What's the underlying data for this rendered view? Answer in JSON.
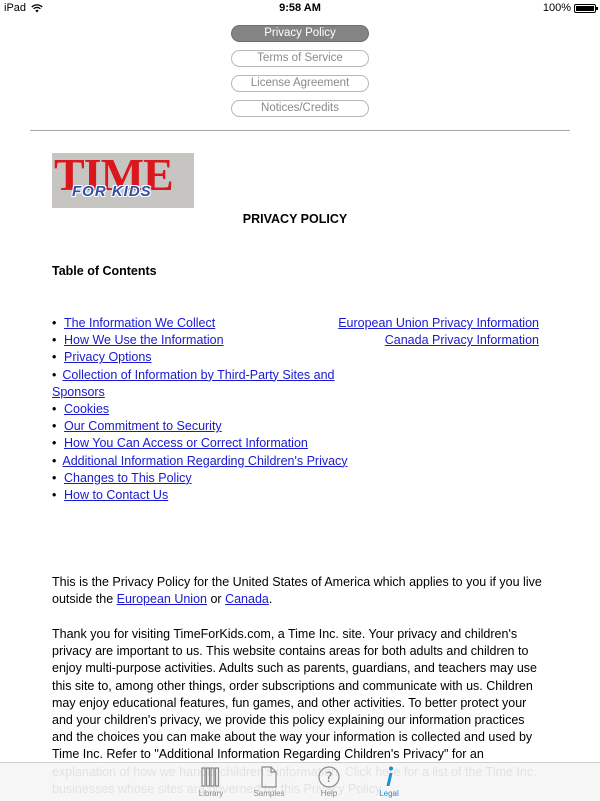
{
  "status_bar": {
    "device": "iPad",
    "time": "9:58 AM",
    "battery": "100%"
  },
  "legal_nav": {
    "buttons": [
      {
        "label": "Privacy Policy",
        "active": true
      },
      {
        "label": "Terms of Service",
        "active": false
      },
      {
        "label": "License Agreement",
        "active": false
      },
      {
        "label": "Notices/Credits",
        "active": false
      }
    ]
  },
  "logo": {
    "line1": "TIME",
    "line2": "FOR KIDS",
    "brand_red": "#d9171c",
    "brand_blue": "#2f4fa8"
  },
  "document": {
    "title": "PRIVACY POLICY",
    "toc_heading": "Table of Contents",
    "toc_left": [
      "The Information We Collect",
      "How We Use the Information",
      "Privacy Options",
      "Collection of Information by Third-Party Sites and Sponsors",
      "Cookies",
      "Our Commitment to Security",
      "How You Can Access or Correct Information",
      "Additional Information Regarding Children's Privacy",
      "Changes to This Policy",
      "How to Contact Us"
    ],
    "toc_right": [
      "European Union Privacy Information",
      "Canada Privacy Information"
    ],
    "para1": {
      "before": "This is the Privacy Policy for the United States of America which applies to you if you live outside the ",
      "link1": "European Union",
      "middle": " or ",
      "link2": "Canada",
      "after": "."
    },
    "para2": "Thank you for visiting TimeForKids.com, a Time Inc. site. Your privacy and children's privacy are important to us. This website contains areas for both adults and children to enjoy multi-purpose activities. Adults such as parents, guardians, and teachers may use this site to, among other things, order subscriptions and communicate with us. Children may enjoy educational features, fun games, and other activities. To better protect your and your children's privacy, we provide this policy explaining our information practices and the choices you can make about the way your information is collected and used by Time Inc. Refer to \"Additional Information Regarding Children's Privacy\" for an explanation of how we handle children's information. Click here for a list of the Time Inc. businesses whose sites are governed by this Privacy Policy."
  },
  "tab_bar": {
    "tabs": [
      {
        "label": "Library",
        "icon": "books-icon",
        "active": false
      },
      {
        "label": "Samples",
        "icon": "document-icon",
        "active": false
      },
      {
        "label": "Help",
        "icon": "question-icon",
        "active": false
      },
      {
        "label": "Legal",
        "icon": "info-icon",
        "active": true
      }
    ],
    "active_color": "#1a8fd8"
  }
}
